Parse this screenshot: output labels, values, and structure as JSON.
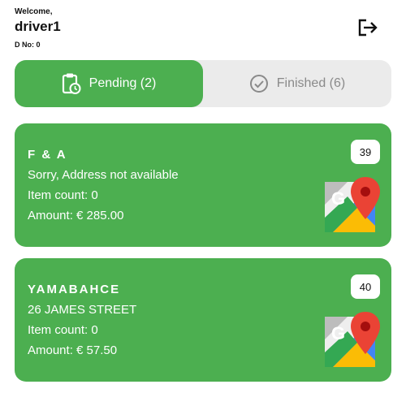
{
  "header": {
    "welcome": "Welcome,",
    "username": "driver1",
    "driver_no": "D No: 0",
    "logout_icon": "logout-icon"
  },
  "tabs": [
    {
      "label": "Pending (2)",
      "icon": "clipboard-clock-icon",
      "active": true
    },
    {
      "label": "Finished (6)",
      "icon": "check-circle-icon",
      "active": false
    }
  ],
  "orders": [
    {
      "name": "F & A",
      "address": "Sorry, Address not available",
      "item_count": "Item count: 0",
      "amount": "Amount: € 285.00",
      "number": "39",
      "map_icon": "google-maps-icon"
    },
    {
      "name": "YAMABAHCE",
      "address": "26 JAMES STREET",
      "item_count": "Item count: 0",
      "amount": "Amount: € 57.50",
      "number": "40",
      "map_icon": "google-maps-icon"
    }
  ],
  "colors": {
    "accent": "#4caf50",
    "tab_inactive_bg": "#ebebeb",
    "tab_inactive_text": "#8a8a8a"
  }
}
